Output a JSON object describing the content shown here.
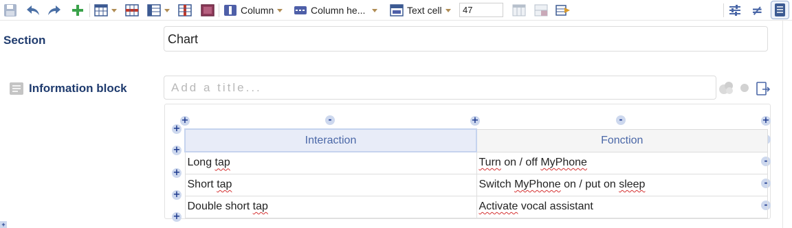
{
  "toolbar": {
    "column_label": "Column",
    "column_header_label": "Column he...",
    "cell_type_label": "Text cell",
    "size_value": "47",
    "icons": [
      "save-icon",
      "undo-icon",
      "redo-icon",
      "add-icon",
      "table-icon",
      "insert-row-icon",
      "insert-column-icon",
      "split-column-icon",
      "merge-cells-icon",
      "column-icon",
      "column-header-icon",
      "text-cell-icon",
      "cell-style-icon",
      "cell-style-2-icon",
      "export-icon",
      "settings-sliders-icon",
      "not-equal-icon",
      "document-view-icon"
    ]
  },
  "section": {
    "label": "Section",
    "value": "Chart"
  },
  "info_block": {
    "label": "Information block",
    "title_placeholder": "Add a title..."
  },
  "table": {
    "headers": [
      "Interaction",
      "Fonction"
    ],
    "rows": [
      {
        "interaction": [
          "Long ",
          "tap"
        ],
        "function": [
          "Turn",
          " on / off ",
          "MyPhone"
        ]
      },
      {
        "interaction": [
          "Short ",
          "tap"
        ],
        "function": [
          "Switch ",
          "MyPhone",
          " on / put on ",
          "sleep"
        ]
      },
      {
        "interaction": [
          "Double short ",
          "tap"
        ],
        "function": [
          "Activate",
          " vocal assistant"
        ]
      }
    ]
  },
  "controls": {
    "plus": "+",
    "minus": "-"
  },
  "colors": {
    "accent": "#1f3b6e",
    "header_text": "#4a67a7",
    "control_bg": "#cdd8ee",
    "spell_underline": "#d53030"
  }
}
